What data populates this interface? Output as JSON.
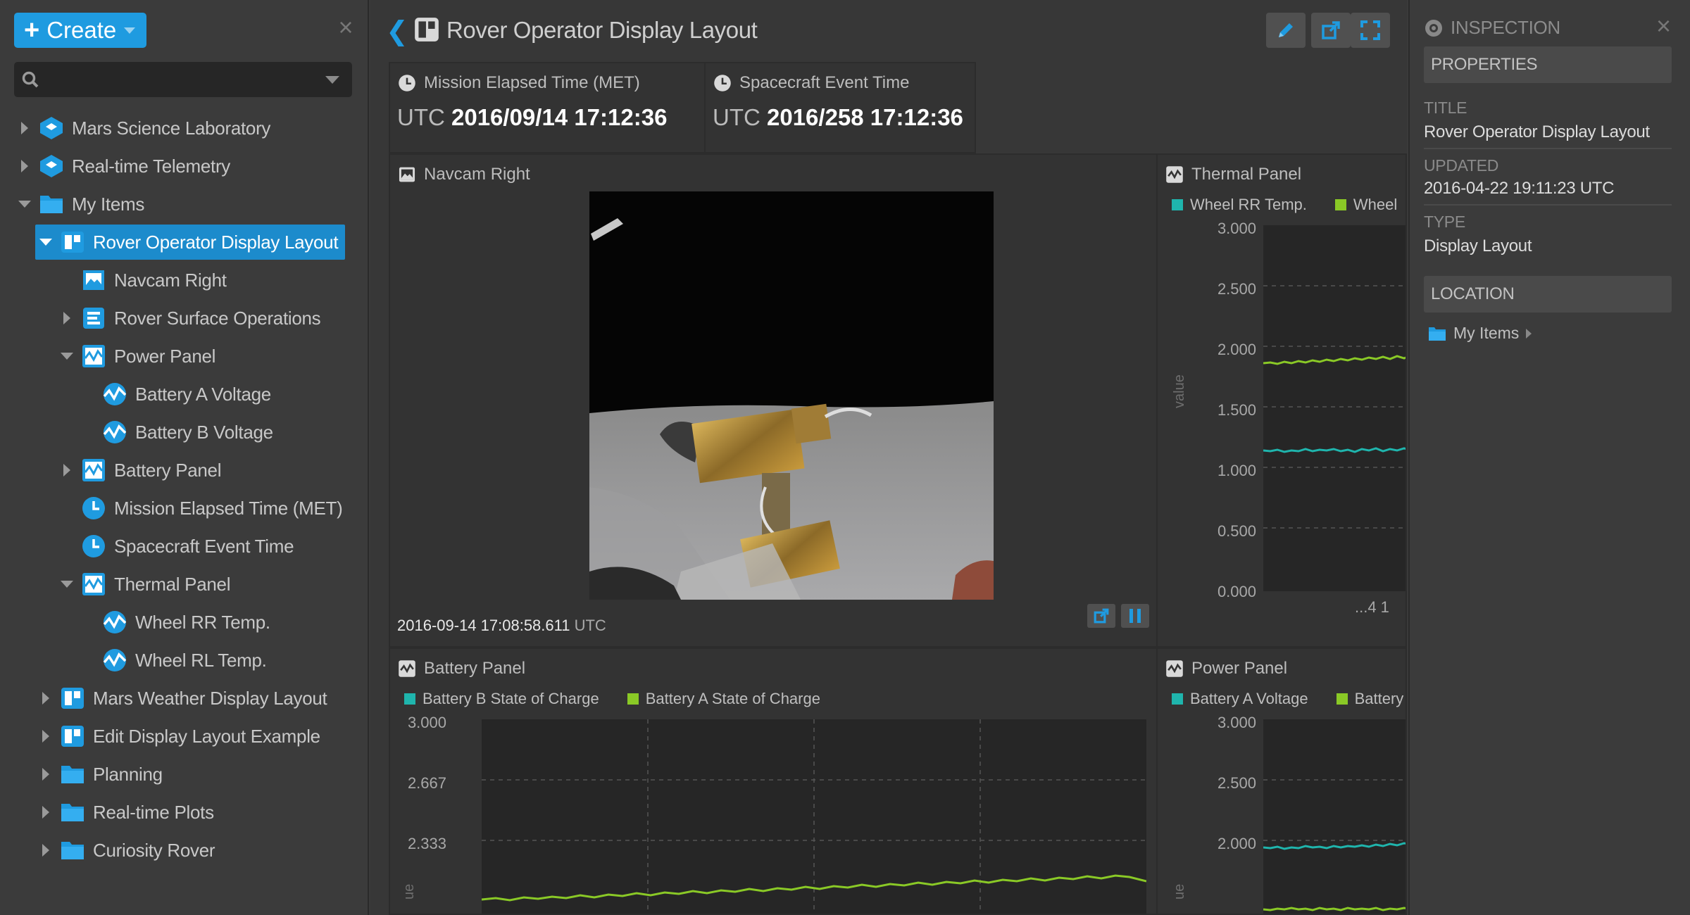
{
  "left": {
    "create_label": "Create",
    "search_placeholder": "",
    "tree": [
      {
        "label": "Mars Science Laboratory",
        "icon": "mission-icon"
      },
      {
        "label": "Real-time Telemetry",
        "icon": "mission-icon"
      },
      {
        "label": "My Items",
        "icon": "folder-icon"
      },
      {
        "label": "Rover Operator Display Layout",
        "icon": "layout-icon"
      },
      {
        "label": "Navcam Right",
        "icon": "image-icon"
      },
      {
        "label": "Rover Surface Operations",
        "icon": "timeline-icon"
      },
      {
        "label": "Power Panel",
        "icon": "plot-icon"
      },
      {
        "label": "Battery A Voltage",
        "icon": "telemetry-icon"
      },
      {
        "label": "Battery B Voltage",
        "icon": "telemetry-icon"
      },
      {
        "label": "Battery Panel",
        "icon": "plot-icon"
      },
      {
        "label": "Mission Elapsed Time (MET)",
        "icon": "clock-icon"
      },
      {
        "label": "Spacecraft Event Time",
        "icon": "clock-icon"
      },
      {
        "label": "Thermal Panel",
        "icon": "plot-icon"
      },
      {
        "label": "Wheel RR Temp.",
        "icon": "telemetry-icon"
      },
      {
        "label": "Wheel RL Temp.",
        "icon": "telemetry-icon"
      },
      {
        "label": "Mars Weather Display Layout",
        "icon": "layout-icon"
      },
      {
        "label": "Edit Display Layout Example",
        "icon": "layout-icon"
      },
      {
        "label": "Planning",
        "icon": "folder-icon"
      },
      {
        "label": "Real-time Plots",
        "icon": "folder-icon"
      },
      {
        "label": "Curiosity Rover",
        "icon": "folder-icon"
      }
    ]
  },
  "center": {
    "title": "Rover Operator Display Layout",
    "met": {
      "label": "Mission Elapsed Time (MET)",
      "prefix": "UTC",
      "value": "2016/09/14 17:12:36"
    },
    "scet": {
      "label": "Spacecraft Event Time",
      "prefix": "UTC",
      "value": "2016/258 17:12:36"
    },
    "navcam": {
      "label": "Navcam Right",
      "timestamp": "2016-09-14 17:08:58.611",
      "tz": "UTC"
    },
    "thermal": {
      "label": "Thermal Panel",
      "legend": [
        "Wheel RR Temp.",
        "Wheel"
      ],
      "y_ticks": [
        "3.000",
        "2.500",
        "2.000",
        "1.500",
        "1.000",
        "0.500",
        "0.000"
      ],
      "ylabel": "value",
      "x_tick": "...4 1"
    },
    "battery": {
      "label": "Battery Panel",
      "legend": [
        "Battery B State of Charge",
        "Battery A State of Charge"
      ],
      "y_ticks": [
        "3.000",
        "2.667",
        "2.333"
      ],
      "ylabel": "ue"
    },
    "power": {
      "label": "Power Panel",
      "legend": [
        "Battery A Voltage",
        "Battery"
      ],
      "y_ticks": [
        "3.000",
        "2.500",
        "2.000"
      ],
      "ylabel": "ue"
    }
  },
  "inspector": {
    "header": "INSPECTION",
    "properties": "PROPERTIES",
    "title_label": "TITLE",
    "title_value": "Rover Operator Display Layout",
    "updated_label": "UPDATED",
    "updated_value": "2016-04-22 19:11:23 UTC",
    "type_label": "TYPE",
    "type_value": "Display Layout",
    "location": "LOCATION",
    "location_item": "My Items"
  },
  "colors": {
    "accent": "#1f9be0",
    "selected": "#1c8bcc",
    "series_cyan": "#1fb5ad",
    "series_lime": "#8ac926"
  }
}
